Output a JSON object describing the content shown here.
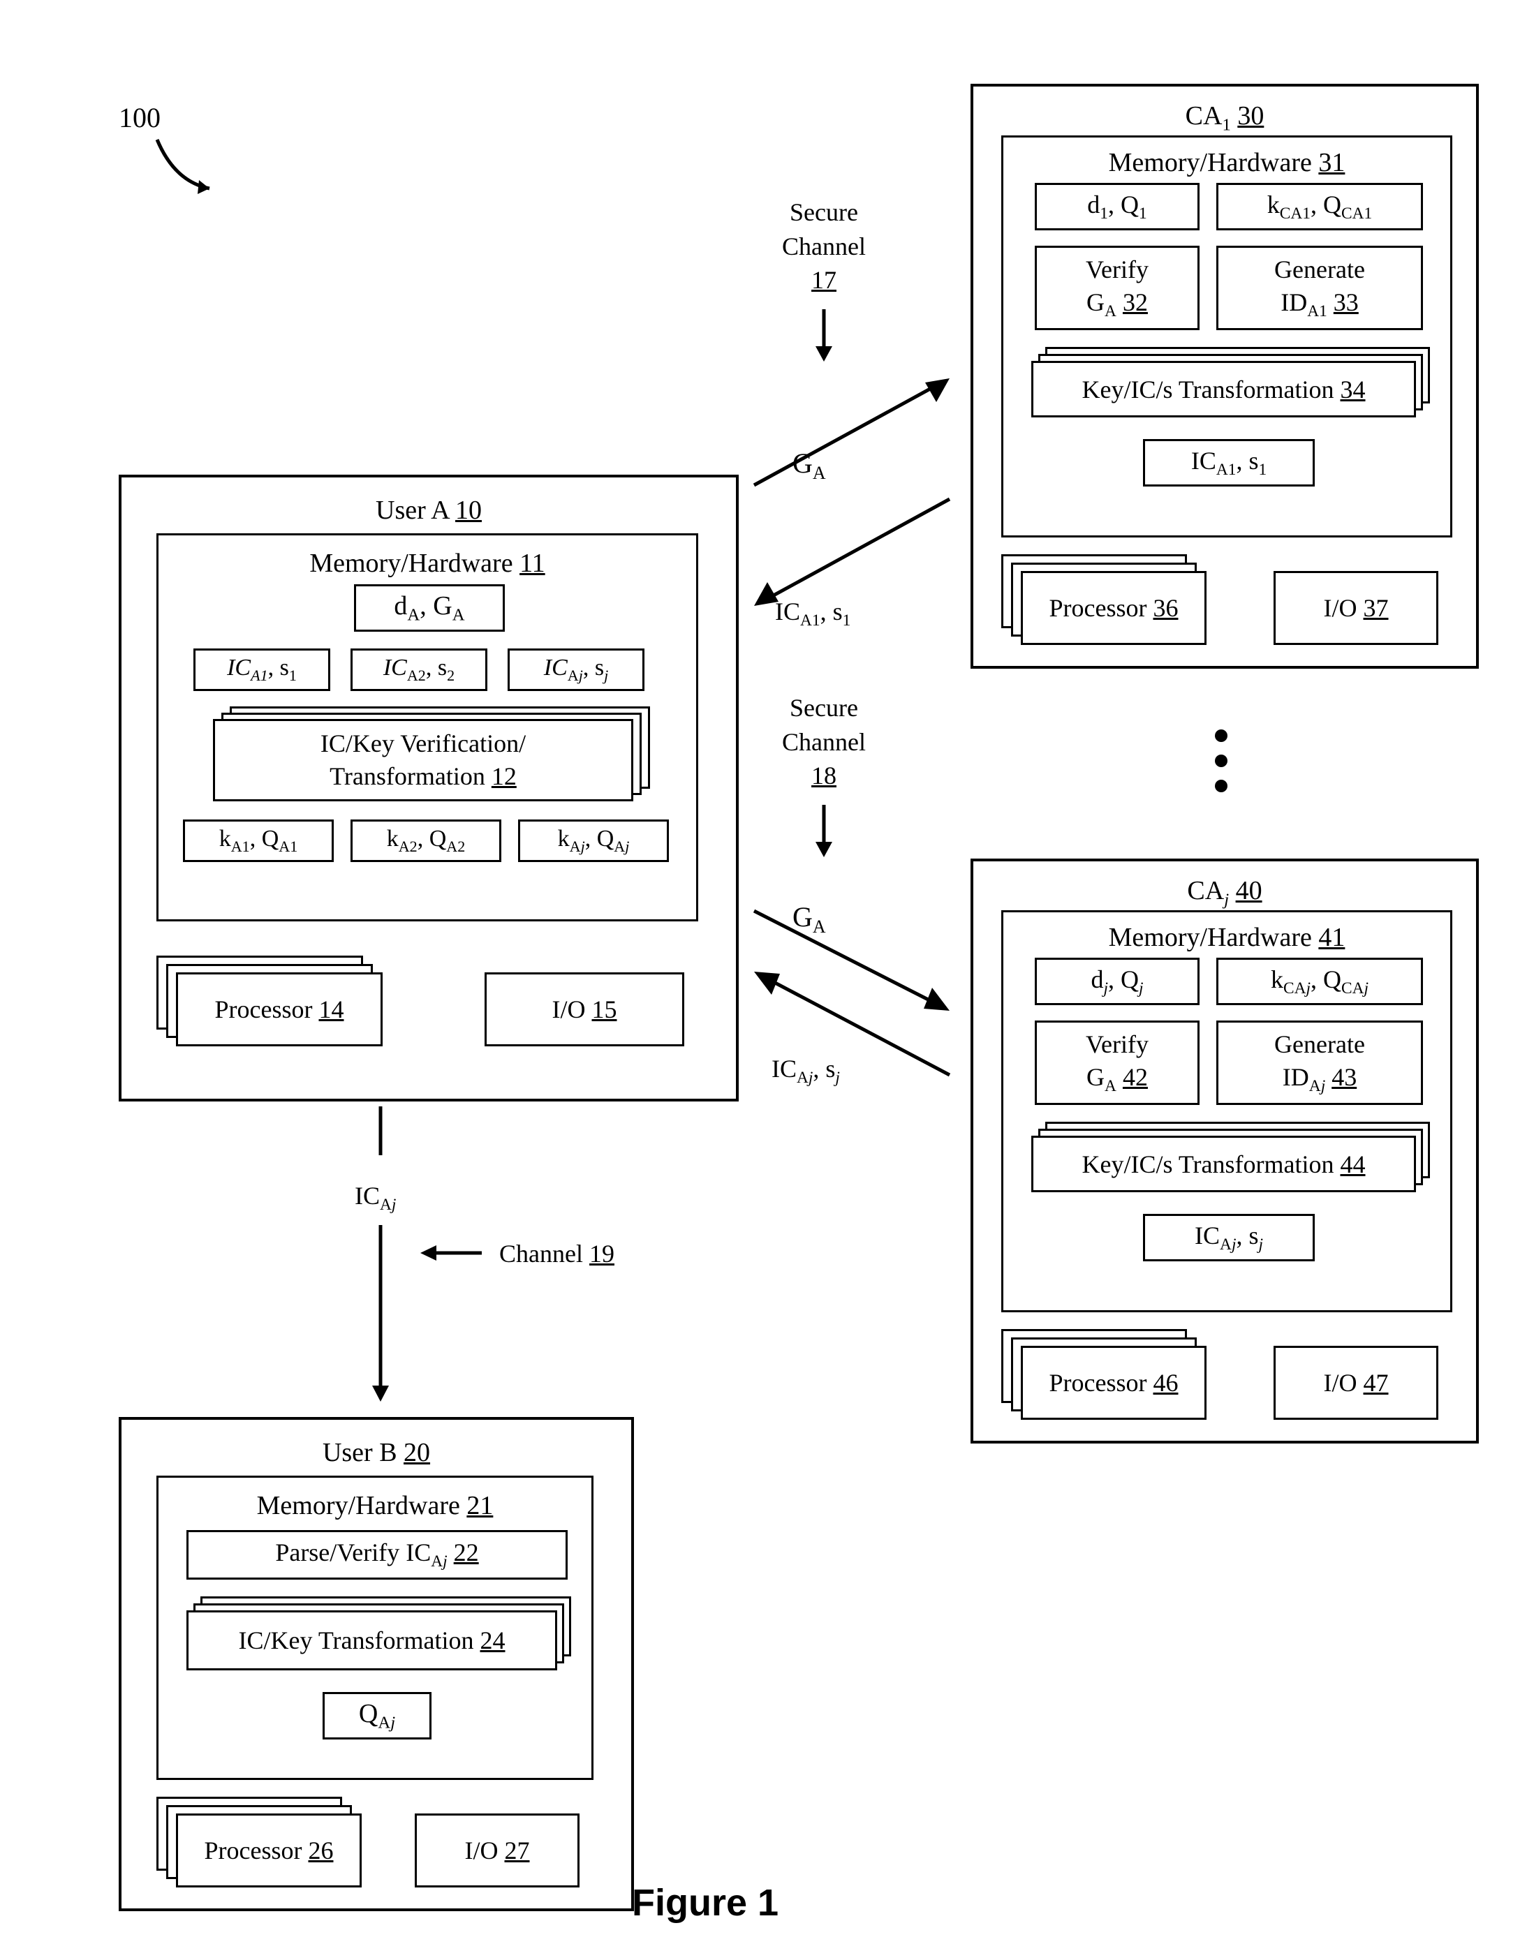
{
  "figure_caption": "Figure 1",
  "ref_100": "100",
  "userA": {
    "title_text": "User A",
    "title_ref": "10",
    "mem_text": "Memory/Hardware",
    "mem_ref": "11",
    "keys_top": "d",
    "keys_top2": ", G",
    "ic1": "IC",
    "ic1_sub": "A1",
    "ic1_rest": ", s",
    "ic1_subn": "1",
    "ic2": "IC",
    "ic2_sub": "A2",
    "ic2_rest": ", s",
    "ic2_subn": "2",
    "icj": "IC",
    "icj_sub": "Aj",
    "icj_rest": ", s",
    "icj_subn": "j",
    "icver_line1": "IC/Key Verification/",
    "icver_line2_text": "Transformation",
    "icver_line2_ref": "12",
    "k1": "k",
    "k1_sub": "A1",
    "k1_rest": ", Q",
    "k1_subn": "A1",
    "k2": "k",
    "k2_sub": "A2",
    "k2_rest": ", Q",
    "k2_subn": "A2",
    "kj": "k",
    "kj_sub": "Aj",
    "kj_rest": ", Q",
    "kj_subn": "Aj",
    "proc_text": "Processor",
    "proc_ref": "14",
    "io_text": "I/O",
    "io_ref": "15"
  },
  "userB": {
    "title_text": "User B",
    "title_ref": "20",
    "mem_text": "Memory/Hardware",
    "mem_ref": "21",
    "parse_text": "Parse/Verify IC",
    "parse_sub": "Aj",
    "parse_ref": "22",
    "ictrans_text": "IC/Key Transformation",
    "ictrans_ref": "24",
    "q_text": "Q",
    "q_sub": "Aj",
    "proc_text": "Processor",
    "proc_ref": "26",
    "io_text": "I/O",
    "io_ref": "27"
  },
  "ca1": {
    "title_text": "CA",
    "title_sub": "1",
    "title_ref": "30",
    "mem_text": "Memory/Hardware",
    "mem_ref": "31",
    "d_text": "d",
    "d_sub": "1",
    "q_text": ", Q",
    "q_sub": "1",
    "k_text": "k",
    "k_sub": "CA1",
    "kq_text": ", Q",
    "kq_sub": "CA1",
    "verify_line1": "Verify",
    "verify_line2_text": "G",
    "verify_line2_sub": "A",
    "verify_ref": "32",
    "gen_line1": "Generate",
    "gen_line2_text": "ID",
    "gen_line2_sub": "A1",
    "gen_ref": "33",
    "key_text": "Key/IC/s Transformation",
    "key_ref": "34",
    "ic_text": "IC",
    "ic_sub": "A1",
    "s_text": ", s",
    "s_sub": "1",
    "proc_text": "Processor",
    "proc_ref": "36",
    "io_text": "I/O",
    "io_ref": "37"
  },
  "caj": {
    "title_text": "CA",
    "title_sub": "j",
    "title_ref": "40",
    "mem_text": "Memory/Hardware",
    "mem_ref": "41",
    "d_text": "d",
    "d_sub": "j",
    "q_text": ", Q",
    "q_sub": "j",
    "k_text": "k",
    "k_sub": "CAj",
    "kq_text": ", Q",
    "kq_sub": "CAj",
    "verify_line1": "Verify",
    "verify_line2_text": "G",
    "verify_line2_sub": "A",
    "verify_ref": "42",
    "gen_line1": "Generate",
    "gen_line2_text": "ID",
    "gen_line2_sub": "Aj",
    "gen_ref": "43",
    "key_text": "Key/IC/s Transformation",
    "key_ref": "44",
    "ic_text": "IC",
    "ic_sub": "Aj",
    "s_text": ", s",
    "s_sub": "j",
    "proc_text": "Processor",
    "proc_ref": "46",
    "io_text": "I/O",
    "io_ref": "47"
  },
  "arrows": {
    "sc17_line1": "Secure",
    "sc17_line2": "Channel",
    "sc17_ref": "17",
    "sc18_line1": "Secure",
    "sc18_line2": "Channel",
    "sc18_ref": "18",
    "channel19_text": "Channel",
    "channel19_ref": "19",
    "ga": "G",
    "ga_sub": "A",
    "ica1": "IC",
    "ica1_sub": "A1",
    "ica1_rest": ", s",
    "ica1_subn": "1",
    "icaj": "IC",
    "icaj_sub": "Aj",
    "icaj_rest": ", s",
    "icaj_subn": "j",
    "icaj_alone": "IC",
    "icaj_alone_sub": "Aj"
  }
}
